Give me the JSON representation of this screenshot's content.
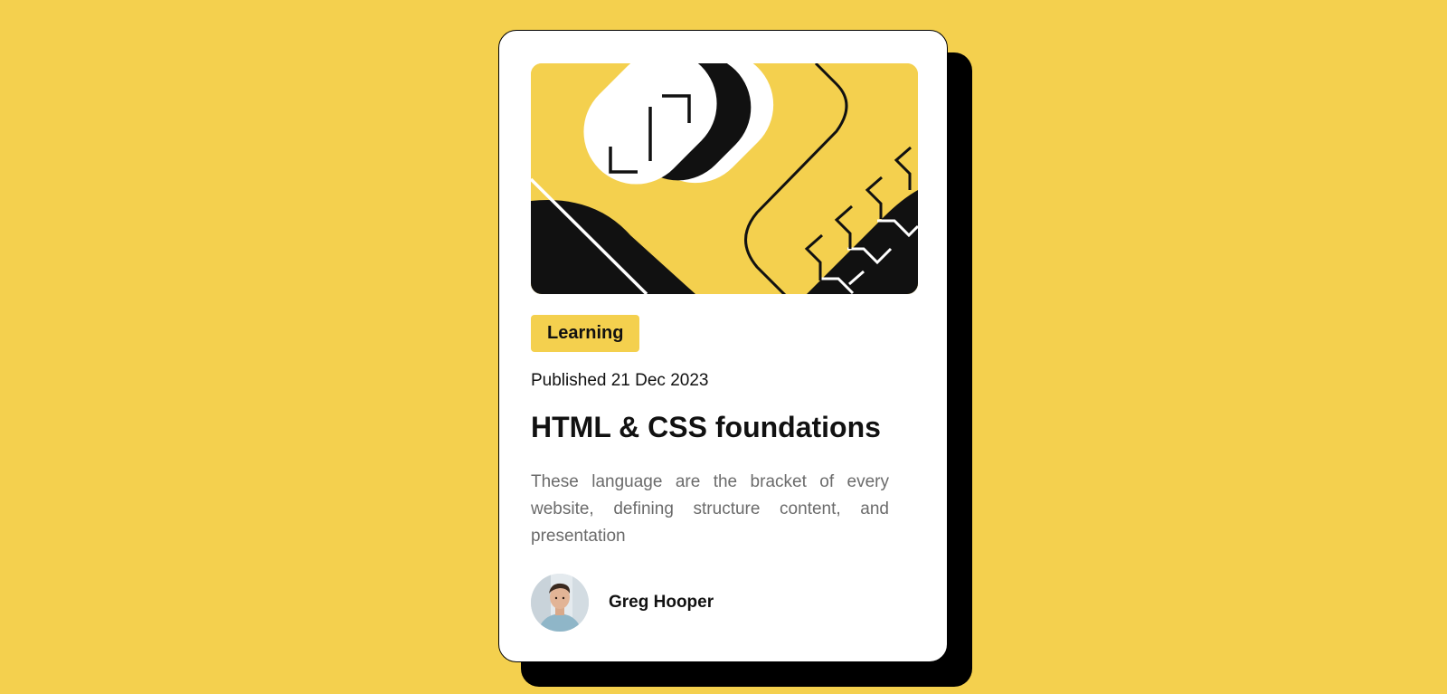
{
  "card": {
    "hero_image": "abstract-geometric-illustration",
    "category_tag": "Learning",
    "published": "Published 21 Dec 2023",
    "title": "HTML & CSS foundations",
    "description": "These language are the bracket of every website, defining structure content, and presentation",
    "author": {
      "name": "Greg Hooper",
      "avatar": "author-portrait-photo"
    }
  },
  "colors": {
    "background": "#F4D04E",
    "card": "#FFFFFF",
    "shadow": "#000000",
    "text": "#111111",
    "muted_text": "#6B6B6B"
  }
}
